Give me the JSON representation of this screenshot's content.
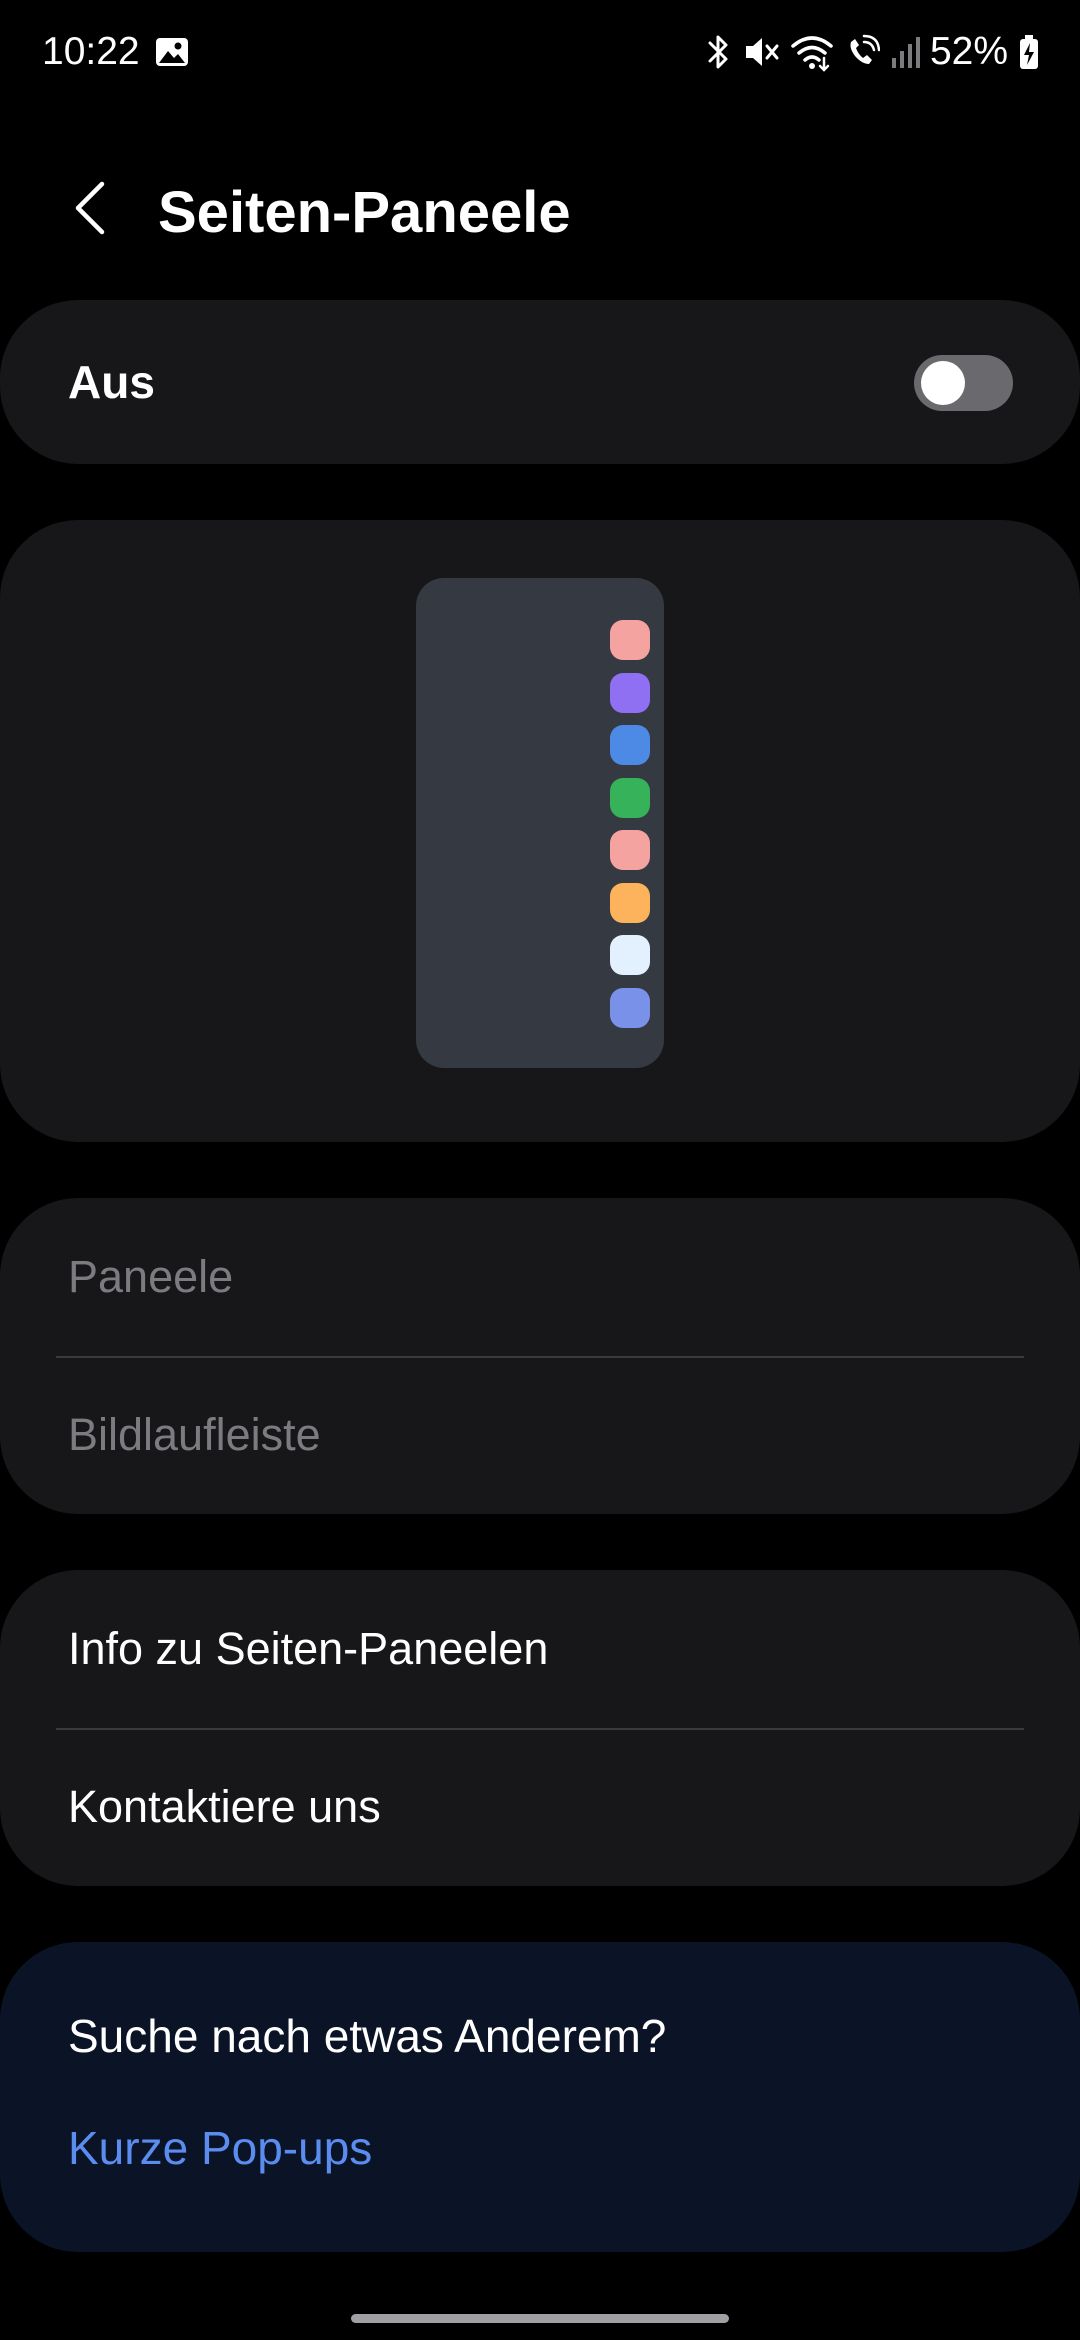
{
  "status_bar": {
    "time": "10:22",
    "battery": "52%",
    "icons": [
      "gallery-icon",
      "bluetooth-icon",
      "mute-icon",
      "wifi-icon",
      "wifi-calling-icon",
      "signal-icon",
      "battery-charging-icon"
    ]
  },
  "header": {
    "back_icon": "chevron-left-icon",
    "title": "Seiten-Paneele"
  },
  "master_switch": {
    "label": "Aus",
    "enabled": false
  },
  "preview": {
    "app_colors": [
      "#f4a3a0",
      "#8f70f2",
      "#4d8ae6",
      "#36b35a",
      "#f4a3a0",
      "#fdb35c",
      "#e2f1fd",
      "#7a91ea"
    ]
  },
  "settings": {
    "items": [
      {
        "label": "Paneele"
      },
      {
        "label": "Bildlaufleiste"
      }
    ]
  },
  "support": {
    "items": [
      {
        "label": "Info zu Seiten-Paneelen"
      },
      {
        "label": "Kontaktiere uns"
      }
    ]
  },
  "suggestion": {
    "title": "Suche nach etwas Anderem?",
    "link": "Kurze Pop-ups",
    "link_color": "#5b8cf0"
  },
  "colors": {
    "background": "#000000",
    "card": "#17171a",
    "suggestion_card": "#0b1427",
    "accent": "#5b8cf0"
  }
}
